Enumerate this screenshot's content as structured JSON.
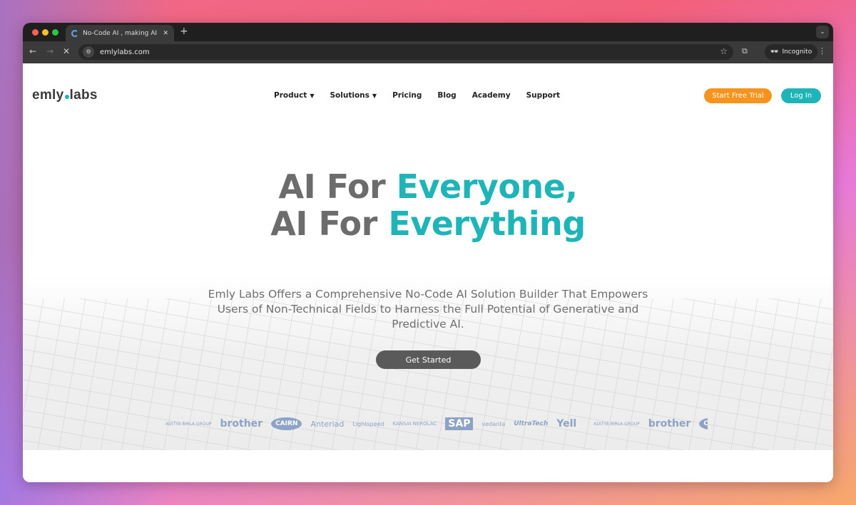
{
  "browser": {
    "tab_title": "No-Code AI , making AI easy",
    "url": "emlylabs.com",
    "profile": "Incognito"
  },
  "nav": {
    "logo_left": "emly",
    "logo_right": "labs",
    "items": [
      {
        "label": "Product",
        "dropdown": true
      },
      {
        "label": "Solutions",
        "dropdown": true
      },
      {
        "label": "Pricing"
      },
      {
        "label": "Blog"
      },
      {
        "label": "Academy"
      },
      {
        "label": "Support"
      }
    ],
    "trial": "Start Free Trial",
    "login": "Log In"
  },
  "hero": {
    "line1_plain": "AI For ",
    "line1_accent": "Everyone,",
    "line2_plain": "AI For ",
    "line2_accent": "Everything",
    "subtitle": "Emly Labs Offers a Comprehensive No-Code AI Solution Builder That Empowers Users of Non-Technical Fields to Harness the Full Potential of Generative and Predictive AI.",
    "cta": "Get Started"
  },
  "clients": [
    "ADITYA BIRLA GROUP",
    "brother",
    "CAIRN",
    "Anteriad",
    "Lightspeed",
    "KANSAI NEROLAC",
    "SAP",
    "vedanta",
    "UltraTech",
    "Yell",
    "ADITYA BIRLA GROUP",
    "brother",
    "CAIRN"
  ],
  "colors": {
    "accent": "#1fb5b8",
    "trial": "#f7941d",
    "heading": "#6c6c6c"
  }
}
